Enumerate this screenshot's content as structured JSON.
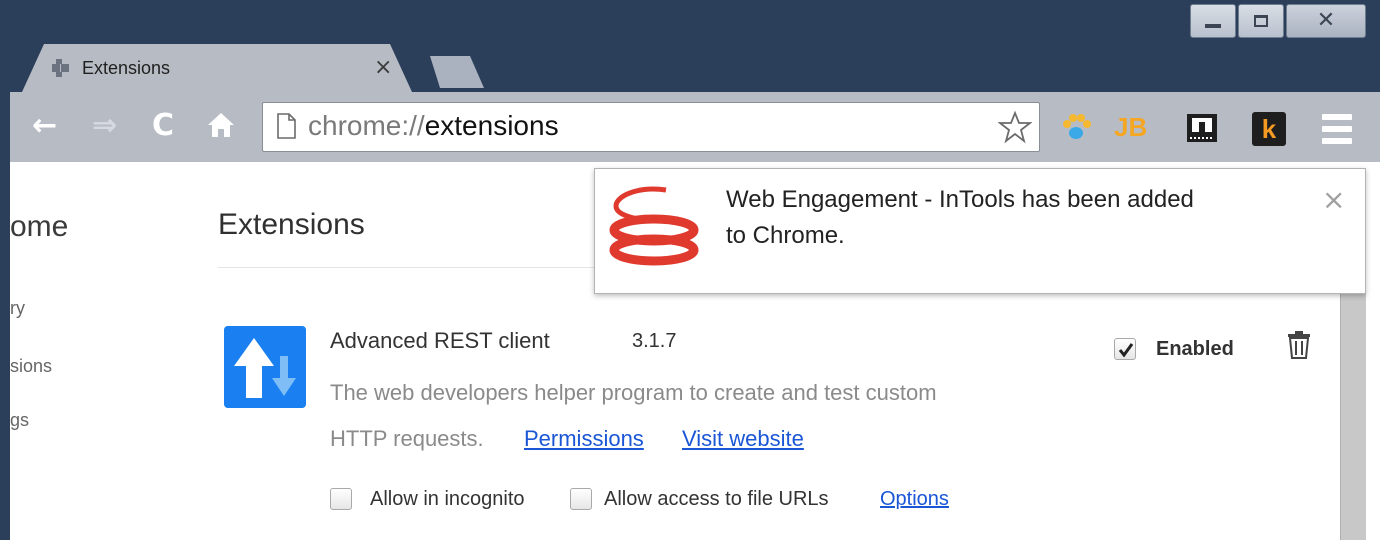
{
  "window": {
    "controls": [
      "minimize",
      "maximize",
      "close"
    ]
  },
  "tab": {
    "title": "Extensions",
    "close_glyph": "×",
    "favicon": "puzzle-icon"
  },
  "toolbar": {
    "back": "←",
    "forward": "⇒",
    "reload": "C",
    "home": "⌂",
    "url_scheme": "chrome://",
    "url_path": "extensions",
    "extensions_icons": [
      "paw-icon",
      "jb-icon",
      "ruler-icon",
      "k-icon"
    ],
    "jb_label": "JB",
    "k_label": "k"
  },
  "sidebar": {
    "title": "ome",
    "items": [
      {
        "label": "ry"
      },
      {
        "label": "sions"
      },
      {
        "label": "gs"
      }
    ]
  },
  "main": {
    "page_title": "Extensions",
    "extension": {
      "name": "Advanced REST client",
      "version": "3.1.7",
      "description_line1": "The web developers helper program to create and test custom",
      "description_line2": "HTTP requests.",
      "permissions_link": "Permissions",
      "website_link": "Visit website",
      "enabled_label": "Enabled",
      "enabled": true,
      "incognito_label": "Allow in incognito",
      "file_urls_label": "Allow access to file URLs",
      "options_link": "Options"
    }
  },
  "notification": {
    "message_line1": "Web Engagement - InTools has been added",
    "message_line2": "to Chrome.",
    "close_glyph": "×"
  },
  "colors": {
    "frame": "#2b3e5a",
    "toolbar": "#b7bcc4",
    "link": "#1a56d6",
    "ext_logo": "#1a7ff0",
    "intools_red": "#e03a2f"
  }
}
